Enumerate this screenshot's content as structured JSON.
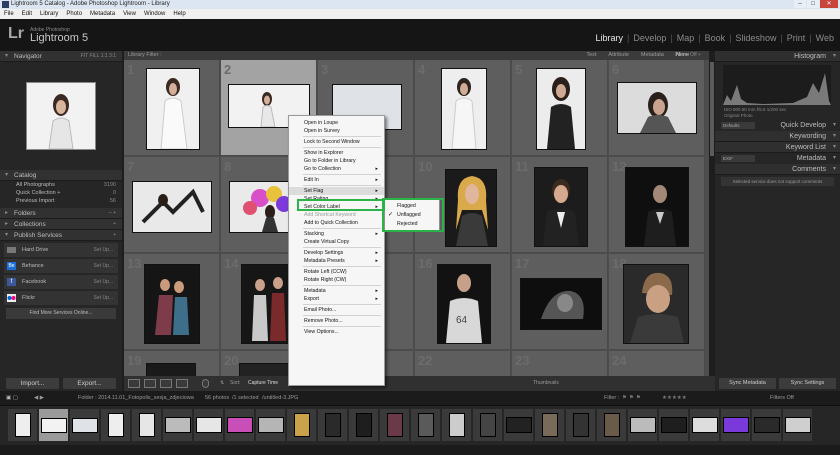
{
  "window": {
    "title": "Lightroom 5 Catalog - Adobe Photoshop Lightroom - Library",
    "controls": [
      "–",
      "□",
      "✕"
    ]
  },
  "menubar": [
    "File",
    "Edit",
    "Library",
    "Photo",
    "Metadata",
    "View",
    "Window",
    "Help"
  ],
  "identity": {
    "logo": "Lr",
    "vendor": "Adobe Photoshop",
    "product": "Lightroom 5"
  },
  "modules": [
    "Library",
    "Develop",
    "Map",
    "Book",
    "Slideshow",
    "Print",
    "Web"
  ],
  "left_panel": {
    "navigator": {
      "title": "Navigator",
      "zoom_options": "FIT   FILL   1:1   3:1"
    },
    "catalog": {
      "title": "Catalog",
      "items": [
        {
          "label": "All Photographs",
          "count": "3190"
        },
        {
          "label": "Quick Collection +",
          "count": "0"
        },
        {
          "label": "Previous Import",
          "count": "56"
        }
      ]
    },
    "folders": {
      "title": "Folders",
      "actions": "–  +"
    },
    "collections": {
      "title": "Collections",
      "actions": "+"
    },
    "publish": {
      "title": "Publish Services",
      "actions": "+",
      "services": [
        {
          "label": "Hard Drive",
          "action": "Set Up..."
        },
        {
          "label": "Behance",
          "action": "Set Up..."
        },
        {
          "label": "Facebook",
          "action": "Set Up..."
        },
        {
          "label": "Flickr",
          "action": "Set Up..."
        }
      ],
      "find_more": "Find More Services Online..."
    },
    "import_button": "Import...",
    "export_button": "Export..."
  },
  "filter_bar": {
    "label": "Library Filter :",
    "tabs": [
      "Text",
      "Attribute",
      "Metadata",
      "None"
    ],
    "active_tab": "None",
    "filters_off": "Filters Off ÷"
  },
  "grid_numbers": [
    "1",
    "2",
    "3",
    "4",
    "5",
    "6",
    "7",
    "8",
    "9",
    "10",
    "11",
    "12",
    "13",
    "14",
    "15",
    "16",
    "17",
    "18",
    "19",
    "20",
    "21",
    "22",
    "23",
    "24"
  ],
  "toolbar": {
    "sort_label": "Sort:",
    "sort_value": "Capture Time",
    "thumbnails_label": "Thumbnails"
  },
  "right_panel": {
    "histogram": {
      "title": "Histogram",
      "info": "ISO 800   50 mm   f/5.6   1/200 sec",
      "original_photo": "Original Photo"
    },
    "quick_develop": {
      "title": "Quick Develop",
      "preset": "Defaults"
    },
    "keywording": {
      "title": "Keywording"
    },
    "keyword_list": {
      "title": "Keyword List",
      "action": "+"
    },
    "metadata": {
      "title": "Metadata",
      "preset": "EXIF"
    },
    "comments": {
      "title": "Comments",
      "message": "Selected service does not support comments"
    },
    "sync_metadata": "Sync Metadata",
    "sync_settings": "Sync Settings"
  },
  "filmstrip_bar": {
    "nav": "◀ ▶",
    "source": "Folder : 2014.11.01_Fotopolis_sesja_zdjeciowa",
    "count": "56 photos",
    "selected": "/1 selected",
    "file": "/untitled-3.JPG",
    "filter_label": "Filter :",
    "filters_off": "Filters Off"
  },
  "context_menu": [
    {
      "label": "Open in Loupe"
    },
    {
      "label": "Open in Survey"
    },
    {
      "sep": true
    },
    {
      "label": "Lock to Second Window"
    },
    {
      "sep": true
    },
    {
      "label": "Show in Explorer"
    },
    {
      "label": "Go to Folder in Library"
    },
    {
      "label": "Go to Collection",
      "arrow": "▸"
    },
    {
      "sep": true
    },
    {
      "label": "Edit In",
      "arrow": "▸"
    },
    {
      "sep": true
    },
    {
      "label": "Set Flag",
      "arrow": "▸",
      "highlight": true
    },
    {
      "label": "Set Rating",
      "arrow": "▸"
    },
    {
      "label": "Set Color Label",
      "arrow": "▸"
    },
    {
      "label": "Add Shortcut Keyword",
      "disabled": true
    },
    {
      "label": "Add to Quick Collection"
    },
    {
      "sep": true
    },
    {
      "label": "Stacking",
      "arrow": "▸"
    },
    {
      "label": "Create Virtual Copy"
    },
    {
      "sep": true
    },
    {
      "label": "Develop Settings",
      "arrow": "▸"
    },
    {
      "label": "Metadata Presets",
      "arrow": "▸"
    },
    {
      "sep": true
    },
    {
      "label": "Rotate Left (CCW)"
    },
    {
      "label": "Rotate Right (CW)"
    },
    {
      "sep": true
    },
    {
      "label": "Metadata",
      "arrow": "▸"
    },
    {
      "label": "Export",
      "arrow": "▸"
    },
    {
      "sep": true
    },
    {
      "label": "Email Photo..."
    },
    {
      "sep": true
    },
    {
      "label": "Remove Photo..."
    },
    {
      "sep": true
    },
    {
      "label": "View Options..."
    }
  ],
  "flag_submenu": [
    {
      "label": "Flagged"
    },
    {
      "label": "Unflagged",
      "checked": true
    },
    {
      "label": "Rejected"
    }
  ],
  "colors": {
    "highlight_box": "#2bb34a",
    "panel": "#262626",
    "grid": "#4d4d4d"
  }
}
